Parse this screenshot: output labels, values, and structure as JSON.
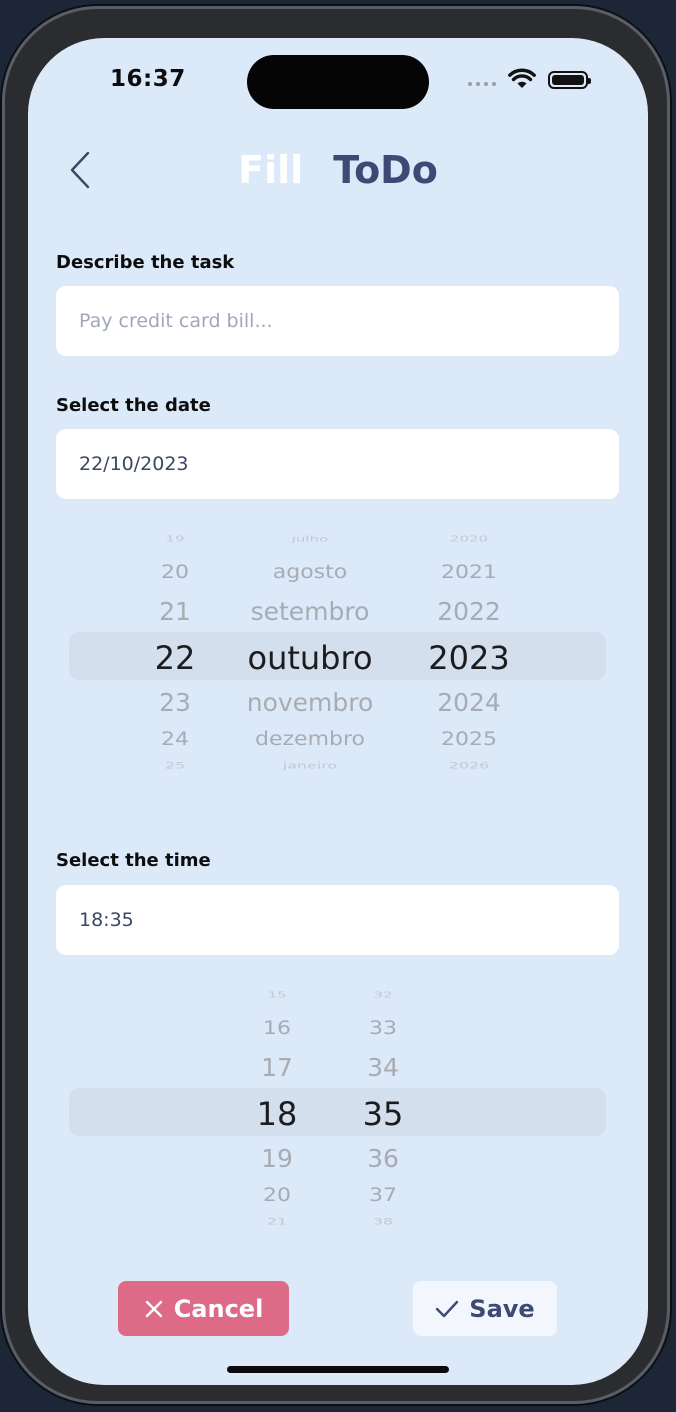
{
  "status": {
    "time": "16:37"
  },
  "header": {
    "title_part1": "Fill",
    "title_part2": "ToDo"
  },
  "task": {
    "label": "Describe the task",
    "placeholder": "Pay credit card bill..."
  },
  "date": {
    "label": "Select the date",
    "value": "22/10/2023",
    "picker": {
      "days": [
        "19",
        "20",
        "21",
        "22",
        "23",
        "24",
        "25"
      ],
      "months": [
        "julho",
        "agosto",
        "setembro",
        "outubro",
        "novembro",
        "dezembro",
        "janeiro"
      ],
      "years": [
        "2020",
        "2021",
        "2022",
        "2023",
        "2024",
        "2025",
        "2026"
      ],
      "selected_index": 3
    }
  },
  "time": {
    "label": "Select the time",
    "value": "18:35",
    "picker": {
      "hours": [
        "15",
        "16",
        "17",
        "18",
        "19",
        "20",
        "21"
      ],
      "minutes": [
        "32",
        "33",
        "34",
        "35",
        "36",
        "37",
        "38"
      ],
      "selected_index": 3
    }
  },
  "actions": {
    "cancel_label": "Cancel",
    "save_label": "Save"
  },
  "colors": {
    "background": "#dce9f9",
    "accent_cancel": "#dd6a86",
    "title_dark": "#3c4a74"
  }
}
